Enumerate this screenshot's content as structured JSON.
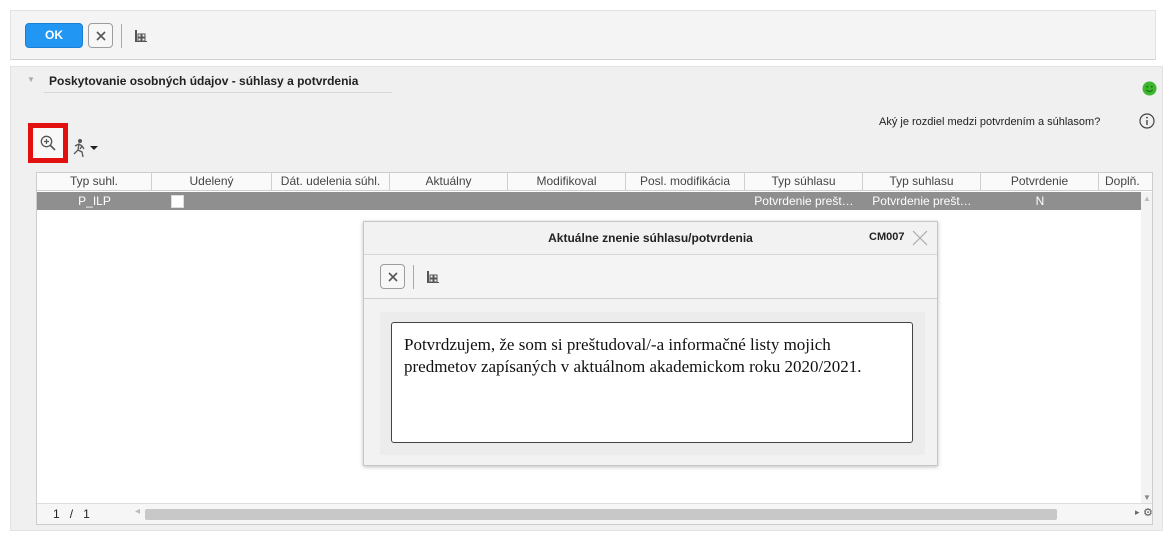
{
  "toolbar": {
    "ok_label": "OK"
  },
  "panel": {
    "title": "Poskytovanie osobných údajov - súhlasy a potvrdenia",
    "help_text": "Aký je rozdiel medzi potvrdením a súhlasom?"
  },
  "table": {
    "columns": [
      "Typ suhl.",
      "Udelený",
      "Dát. udelenia súhl.",
      "Aktuálny",
      "Modifikoval",
      "Posl. modifikácia",
      "Typ súhlasu",
      "Typ suhlasu",
      "Potvrdenie",
      "Doplň."
    ],
    "rows": [
      {
        "typ_suhl": "P_ILP",
        "udeleny": "",
        "dat_udelenia": "",
        "aktualny": "",
        "modifikoval": "",
        "posl_modifikacia": "",
        "typ_suhlasu": "Potvrdenie prešt…",
        "typ_suhlasu2": "Potvrdenie prešt…",
        "potvrdenie": "N",
        "doplnit": ""
      }
    ],
    "pager": {
      "current": "1",
      "separator": "/",
      "total": "1"
    }
  },
  "modal": {
    "title": "Aktuálne znenie súhlasu/potvrdenia",
    "code": "CM007",
    "text": "Potvrdzujem, že som si preštudoval/-a informačné listy mojich predmetov zapísaných v aktuálnom akademickom roku 2020/2021."
  },
  "colors": {
    "ok_button": "#2196f3",
    "highlight": "#e31010",
    "selected_row": "#8f8f8f",
    "status_ok": "#3cb72e"
  },
  "icons": {
    "cancel": "close-icon",
    "columns": "columns-icon",
    "zoom": "zoom-in-icon",
    "runner": "run-icon",
    "status": "smiley-icon",
    "info": "info-icon",
    "gear": "gear-icon"
  }
}
